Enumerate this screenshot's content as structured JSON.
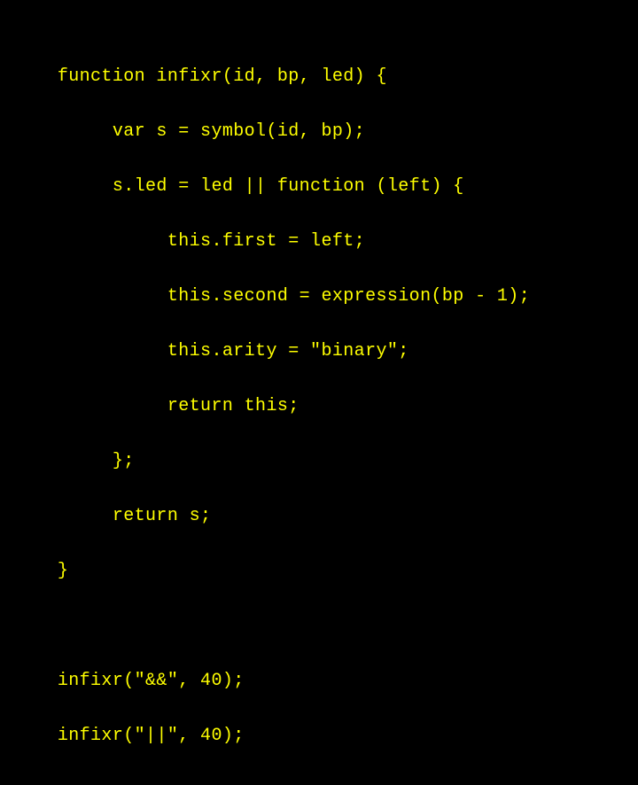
{
  "code": {
    "lines": [
      "function infixr(id, bp, led) {",
      "     var s = symbol(id, bp);",
      "     s.led = led || function (left) {",
      "          this.first = left;",
      "          this.second = expression(bp - 1);",
      "          this.arity = \"binary\";",
      "          return this;",
      "     };",
      "     return s;",
      "}",
      "",
      "infixr(\"&&\", 40);",
      "infixr(\"||\", 40);"
    ]
  }
}
